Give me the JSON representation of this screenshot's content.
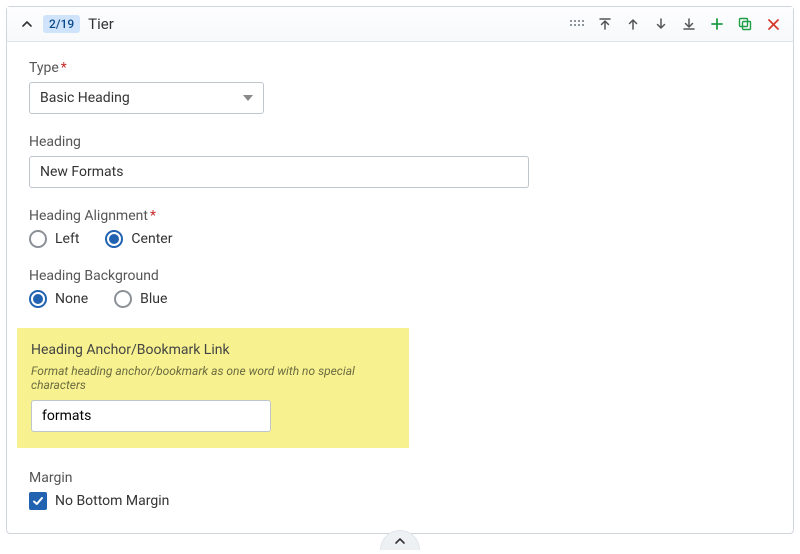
{
  "header": {
    "position_chip": "2/19",
    "title": "Tier"
  },
  "type_field": {
    "label": "Type",
    "required_mark": "*",
    "value": "Basic Heading"
  },
  "heading_field": {
    "label": "Heading",
    "value": "New Formats"
  },
  "alignment_field": {
    "label": "Heading Alignment",
    "required_mark": "*",
    "options": {
      "left": "Left",
      "center": "Center"
    }
  },
  "background_field": {
    "label": "Heading Background",
    "options": {
      "none": "None",
      "blue": "Blue"
    }
  },
  "anchor_field": {
    "label": "Heading Anchor/Bookmark Link",
    "help": "Format heading anchor/bookmark as one word with no special characters",
    "value": "formats"
  },
  "margin_field": {
    "label": "Margin",
    "checkbox_label": "No Bottom Margin"
  }
}
